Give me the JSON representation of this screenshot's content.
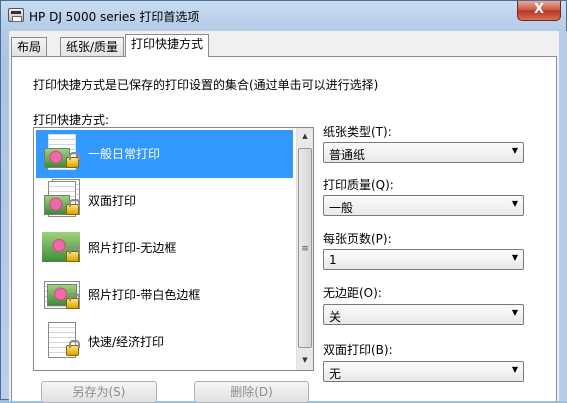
{
  "window": {
    "title": "HP DJ 5000 series 打印首选项",
    "close_glyph": "X"
  },
  "tabs": [
    {
      "label": "布局"
    },
    {
      "label": "纸张/质量"
    },
    {
      "label": "打印快捷方式",
      "active": true
    }
  ],
  "panel": {
    "description": "打印快捷方式是已保存的打印设置的集合(通过单击可以进行选择)",
    "list_label": "打印快捷方式:",
    "shortcuts": [
      {
        "label": "一般日常打印",
        "icon": "document-photo-lock-icon",
        "selected": true
      },
      {
        "label": "双面打印",
        "icon": "duplex-document-lock-icon"
      },
      {
        "label": "照片打印-无边框",
        "icon": "borderless-photo-lock-icon"
      },
      {
        "label": "照片打印-带白色边框",
        "icon": "bordered-photo-lock-icon"
      },
      {
        "label": "快速/经济打印",
        "icon": "document-lock-icon"
      }
    ],
    "save_as_label": "另存为(S)",
    "delete_label": "删除(D)"
  },
  "settings": [
    {
      "label": "纸张类型(T):",
      "value": "普通纸"
    },
    {
      "label": "打印质量(Q):",
      "value": "一般"
    },
    {
      "label": "每张页数(P):",
      "value": "1"
    },
    {
      "label": "无边距(O):",
      "value": "关"
    },
    {
      "label": "双面打印(B):",
      "value": "无"
    }
  ],
  "colors": {
    "selection": "#3399ff",
    "title_bar": "#b4cbe6",
    "close_button": "#c7533d"
  }
}
